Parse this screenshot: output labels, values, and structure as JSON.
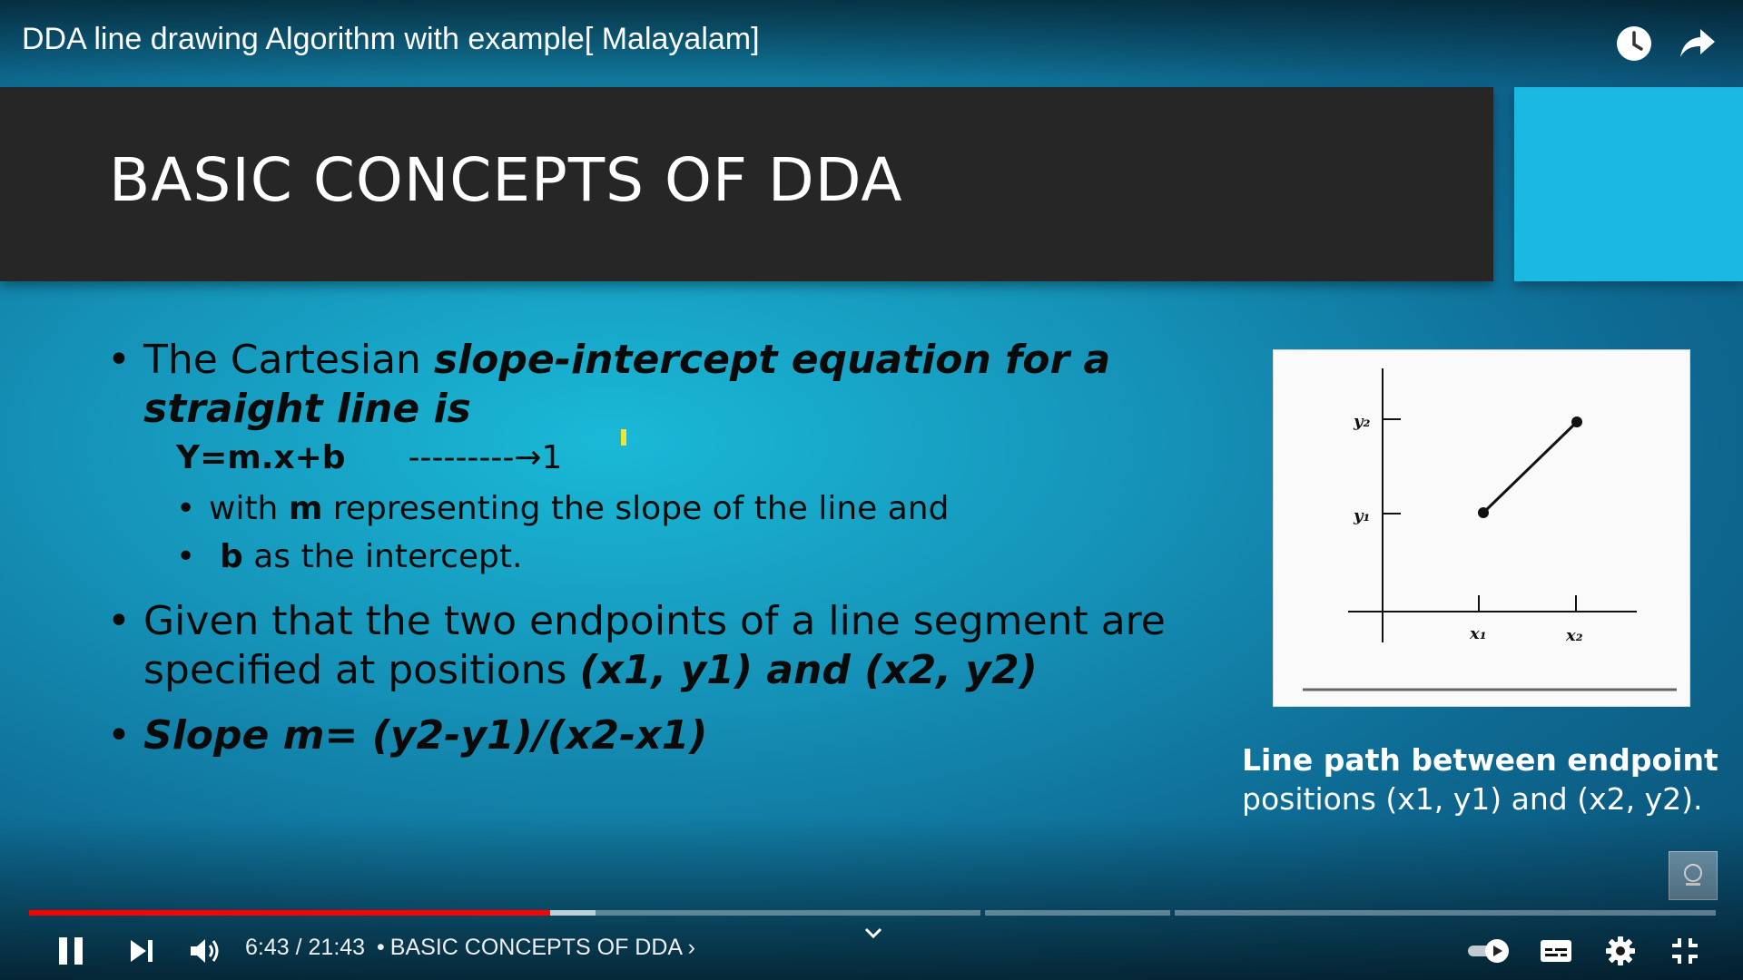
{
  "video": {
    "title": "DDA line drawing Algorithm with example[ Malayalam]"
  },
  "slide": {
    "title": "BASIC CONCEPTS OF DDA",
    "bullet1": {
      "plain": "The Cartesian ",
      "emph": "slope-intercept equation for a straight line is"
    },
    "equation": {
      "text": "Y=m.x+b",
      "arrow": "---------→1"
    },
    "sub1": {
      "pre": "with ",
      "bold": "m",
      "post": " representing the slope of the line and"
    },
    "sub2": {
      "bold": "b",
      "post": " as the intercept."
    },
    "bullet2": {
      "plain": "Given that the two endpoints of a line segment are specified at positions ",
      "emph": "(x1, y1) and (x2, y2)"
    },
    "bullet3": {
      "emph": "Slope m= (y2-y1)/(x2-x1)"
    },
    "figure": {
      "label_y2": "y₂",
      "label_y1": "y₁",
      "label_x1": "x₁",
      "label_x2": "x₂"
    },
    "caption": {
      "line1": "Line path between endpoint",
      "line2": "positions (x1, y1) and (x2, y2)."
    }
  },
  "player": {
    "current_time": "6:43",
    "duration": "21:43",
    "time_separator": " / ",
    "chapter_bullet": "•",
    "chapter": "BASIC CONCEPTS OF DDA",
    "chapter_chevron": "›",
    "progress_fraction": 0.309,
    "buffered_fraction": 0.336,
    "accent": "#ff0000"
  },
  "icons": {
    "watch_later": "clock-icon",
    "share": "share-arrow-icon",
    "pause": "pause-icon",
    "next": "next-icon",
    "volume": "volume-icon",
    "chapters_toggle": "chevron-down-icon",
    "autoplay": "autoplay-toggle-icon",
    "captions": "captions-icon",
    "settings": "gear-icon",
    "exit_fullscreen": "exit-fullscreen-icon"
  }
}
